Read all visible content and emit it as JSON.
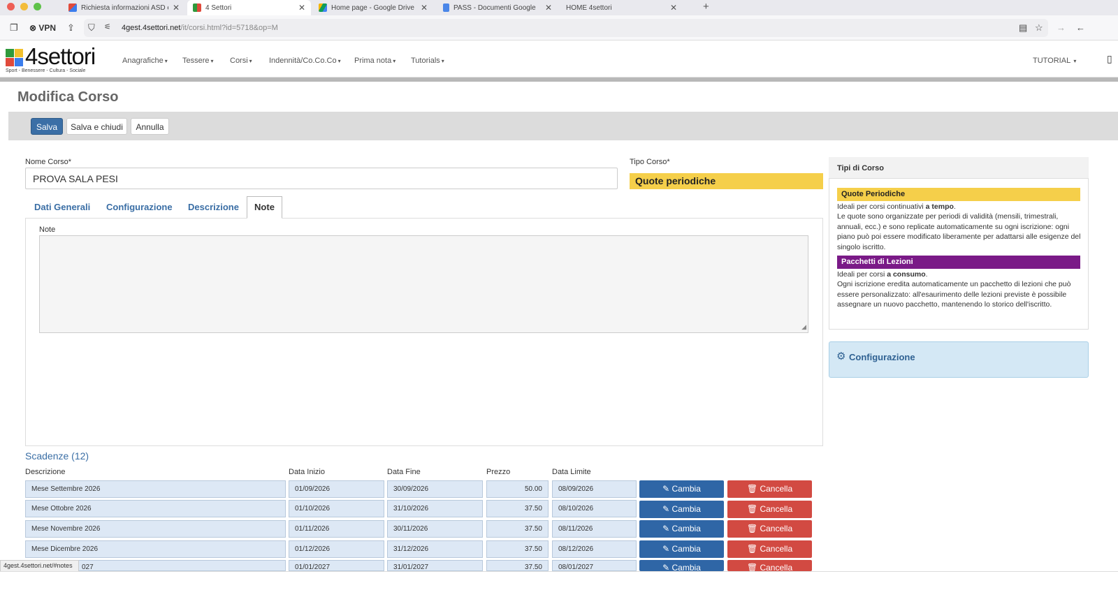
{
  "browser": {
    "tabs": [
      {
        "title": "Richiesta informazioni ASD ed a",
        "icon": "gmail-icon"
      },
      {
        "title": "4 Settori",
        "icon": "4settori-icon"
      },
      {
        "title": "Home page - Google Drive",
        "icon": "drive-icon"
      },
      {
        "title": "PASS - Documenti Google",
        "icon": "docs-icon"
      },
      {
        "title": "HOME 4settori",
        "icon": "none"
      }
    ],
    "vpn_label": "VPN",
    "url_domain": "4gest.4settori.net",
    "url_path": "/it/corsi.html?id=5718&op=M",
    "status_url": "4gest.4settori.net/#notes"
  },
  "nav": {
    "brand": "4settori",
    "slogan": "Sport - Benessere - Cultura - Sociale",
    "items": [
      "Anagrafiche",
      "Tessere",
      "Corsi",
      "Indennità/Co.Co.Co",
      "Prima nota",
      "Tutorials"
    ],
    "user_menu": "TUTORIAL"
  },
  "page": {
    "title": "Modifica Corso",
    "buttons": {
      "save": "Salva",
      "save_close": "Salva e chiudi",
      "cancel": "Annulla"
    }
  },
  "form": {
    "nome_label": "Nome Corso*",
    "nome_value": "PROVA SALA PESI",
    "tipo_label": "Tipo Corso*",
    "tipo_value": "Quote periodiche",
    "tabs": [
      "Dati Generali",
      "Configurazione",
      "Descrizione",
      "Note"
    ],
    "note_label": "Note",
    "note_value": ""
  },
  "scadenze": {
    "title": "Scadenze (12)",
    "headers": [
      "Descrizione",
      "Data Inizio",
      "Data Fine",
      "Prezzo",
      "Data Limite"
    ],
    "cambia_label": "Cambia",
    "cancella_label": "Cancella",
    "rows": [
      {
        "descrizione": "Mese Settembre 2026",
        "inizio": "01/09/2026",
        "fine": "30/09/2026",
        "prezzo": "50.00",
        "limite": "08/09/2026"
      },
      {
        "descrizione": "Mese Ottobre 2026",
        "inizio": "01/10/2026",
        "fine": "31/10/2026",
        "prezzo": "37.50",
        "limite": "08/10/2026"
      },
      {
        "descrizione": "Mese Novembre 2026",
        "inizio": "01/11/2026",
        "fine": "30/11/2026",
        "prezzo": "37.50",
        "limite": "08/11/2026"
      },
      {
        "descrizione": "Mese Dicembre 2026",
        "inizio": "01/12/2026",
        "fine": "31/12/2026",
        "prezzo": "37.50",
        "limite": "08/12/2026"
      },
      {
        "descrizione": "027",
        "inizio": "01/01/2027",
        "fine": "31/01/2027",
        "prezzo": "37.50",
        "limite": "08/01/2027"
      }
    ]
  },
  "side": {
    "tipi_title": "Tipi di Corso",
    "quote_tag": "Quote Periodiche",
    "quote_line1_pre": "Ideali per corsi continuativi ",
    "quote_line1_bold": "a tempo",
    "quote_line1_post": ".",
    "quote_text": "Le quote sono organizzate per periodi di validità (mensili, trimestrali, annuali, ecc.) e sono replicate automaticamente su ogni iscrizione: ogni piano può poi essere modificato liberamente per adattarsi alle esigenze del singolo iscritto.",
    "pacchetti_tag": "Pacchetti di Lezioni",
    "pacchetti_line1_pre": "Ideali per corsi ",
    "pacchetti_line1_bold": "a consumo",
    "pacchetti_line1_post": ".",
    "pacchetti_text": "Ogni iscrizione eredita automaticamente un pacchetto di lezioni che può essere personalizzato: all'esaurimento delle lezioni previste è possibile assegnare un nuovo pacchetto, mantenendo lo storico dell'iscritto.",
    "config_title": "Configurazione"
  },
  "colors": {
    "primary": "#3b6fa6",
    "quote_yellow": "#f5cf4a",
    "pacchetti_purple": "#7a1a87",
    "danger": "#d24a42"
  }
}
